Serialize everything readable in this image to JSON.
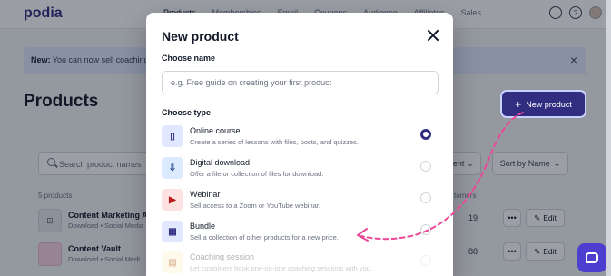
{
  "app": {
    "logo": "podia",
    "nav": [
      "Products",
      "Memberships",
      "Email",
      "Coupons",
      "Audience",
      "Affiliates",
      "Sales"
    ],
    "help_glyph": "?",
    "banner": {
      "label": "New:",
      "text": "You can now sell coaching",
      "close": "×"
    },
    "page_title": "Products",
    "new_product_button": "New product",
    "search_placeholder": "Search product names",
    "filter_label": "tent",
    "sort_label": "Sort by Name",
    "products_count": "5 products",
    "customers_header": "tomers",
    "products": [
      {
        "name": "Content Marketing A",
        "meta": "Download • Social Media",
        "customers": "19",
        "more": "•••",
        "edit": "Edit"
      },
      {
        "name": "Content Vault",
        "meta": "Download • Social Medi",
        "customers": "88",
        "more": "•••",
        "edit": "Edit"
      }
    ]
  },
  "modal": {
    "title": "New product",
    "name_label": "Choose name",
    "name_placeholder": "e.g. Free guide on creating your first product",
    "type_label": "Choose type",
    "types": [
      {
        "name": "Online course",
        "description": "Create a series of lessons with files, posts, and quizzes.",
        "icon": "book-icon",
        "selected": true,
        "disabled": false
      },
      {
        "name": "Digital download",
        "description": "Offer a file or collection of files for download.",
        "icon": "download-icon",
        "selected": false,
        "disabled": false
      },
      {
        "name": "Webinar",
        "description": "Sell access to a Zoom or YouTube webinar.",
        "icon": "video-play-icon",
        "selected": false,
        "disabled": false
      },
      {
        "name": "Bundle",
        "description": "Sell a collection of other products for a new price.",
        "icon": "grid-icon",
        "selected": false,
        "disabled": false
      },
      {
        "name": "Coaching session",
        "description": "Let customers book one-on-one coaching sessions with you.",
        "icon": "calendar-icon",
        "selected": false,
        "disabled": true
      }
    ]
  },
  "colors": {
    "brand": "#312e81",
    "annotation_arrow": "#ec4899",
    "chat_button": "#4c3fcf"
  }
}
